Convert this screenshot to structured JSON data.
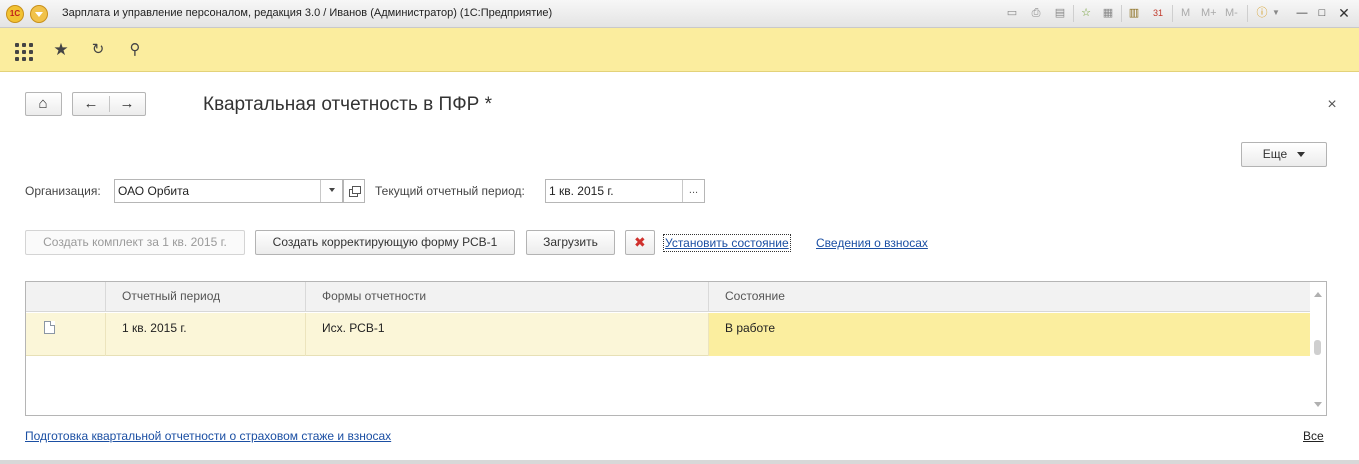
{
  "window": {
    "app_icon_text": "1С",
    "title": "Зарплата и управление персоналом, редакция 3.0 / Иванов (Администратор)  (1С:Предприятие)",
    "toolbar_m": "M",
    "toolbar_mplus": "M+",
    "toolbar_mminus": "M-",
    "calendar_day": "31"
  },
  "form": {
    "title": "Квартальная отчетность в ПФР *",
    "close_glyph": "×",
    "more_button": "Еще"
  },
  "fields": {
    "organization_label": "Организация:",
    "organization_value": "ОАО Орбита",
    "period_label": "Текущий отчетный период:",
    "period_value": "1 кв. 2015 г.",
    "period_choose": "..."
  },
  "actions": {
    "create_set": "Создать комплект за 1 кв. 2015 г.",
    "create_correction": "Создать корректирующую форму РСВ-1",
    "load": "Загрузить",
    "set_state": "Установить состояние",
    "contributions_info": "Сведения о взносах"
  },
  "table": {
    "columns": [
      "",
      "Отчетный период",
      "Формы отчетности",
      "Состояние"
    ],
    "rows": [
      {
        "period": "1 кв. 2015 г.",
        "form": "Исх. РСВ-1",
        "state": "В работе"
      }
    ]
  },
  "footer": {
    "link": "Подготовка квартальной отчетности о страховом стаже и взносах",
    "all": "Все"
  }
}
